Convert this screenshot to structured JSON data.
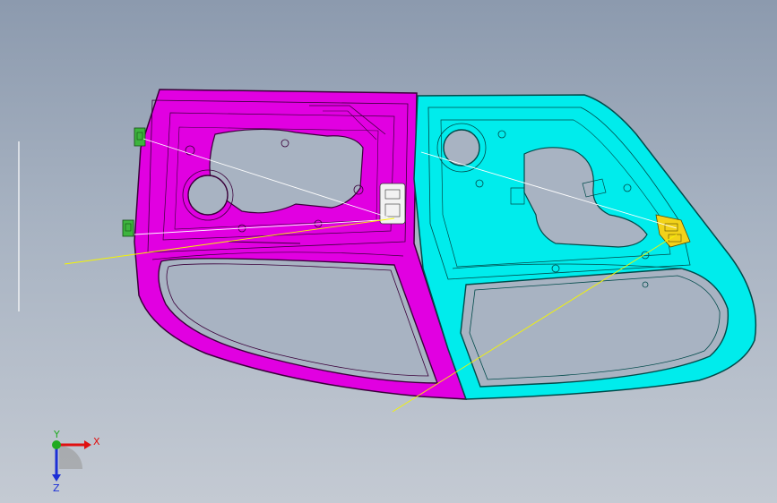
{
  "viewport": {
    "background_top": "#8c9aae",
    "background_bottom": "#c4cad3"
  },
  "parts": [
    {
      "name": "front-door-inner-panel",
      "color": "#e100e1",
      "edge_color": "#3a003a"
    },
    {
      "name": "rear-door-inner-panel",
      "color": "#00ecec",
      "edge_color": "#004a4a"
    }
  ],
  "hardware_colors": {
    "hinge_green": "#3db43d",
    "latch_white": "#f2f2f2",
    "latch_yellow": "#f2d21a"
  },
  "sketch_lines": {
    "color_white": "#ffffff",
    "color_yellow": "#f5f500"
  },
  "triad": {
    "x_label": "X",
    "y_label": "Y",
    "z_label": "Z",
    "x_color": "#e01010",
    "y_color": "#1faa1f",
    "z_color": "#1c2fd6"
  }
}
